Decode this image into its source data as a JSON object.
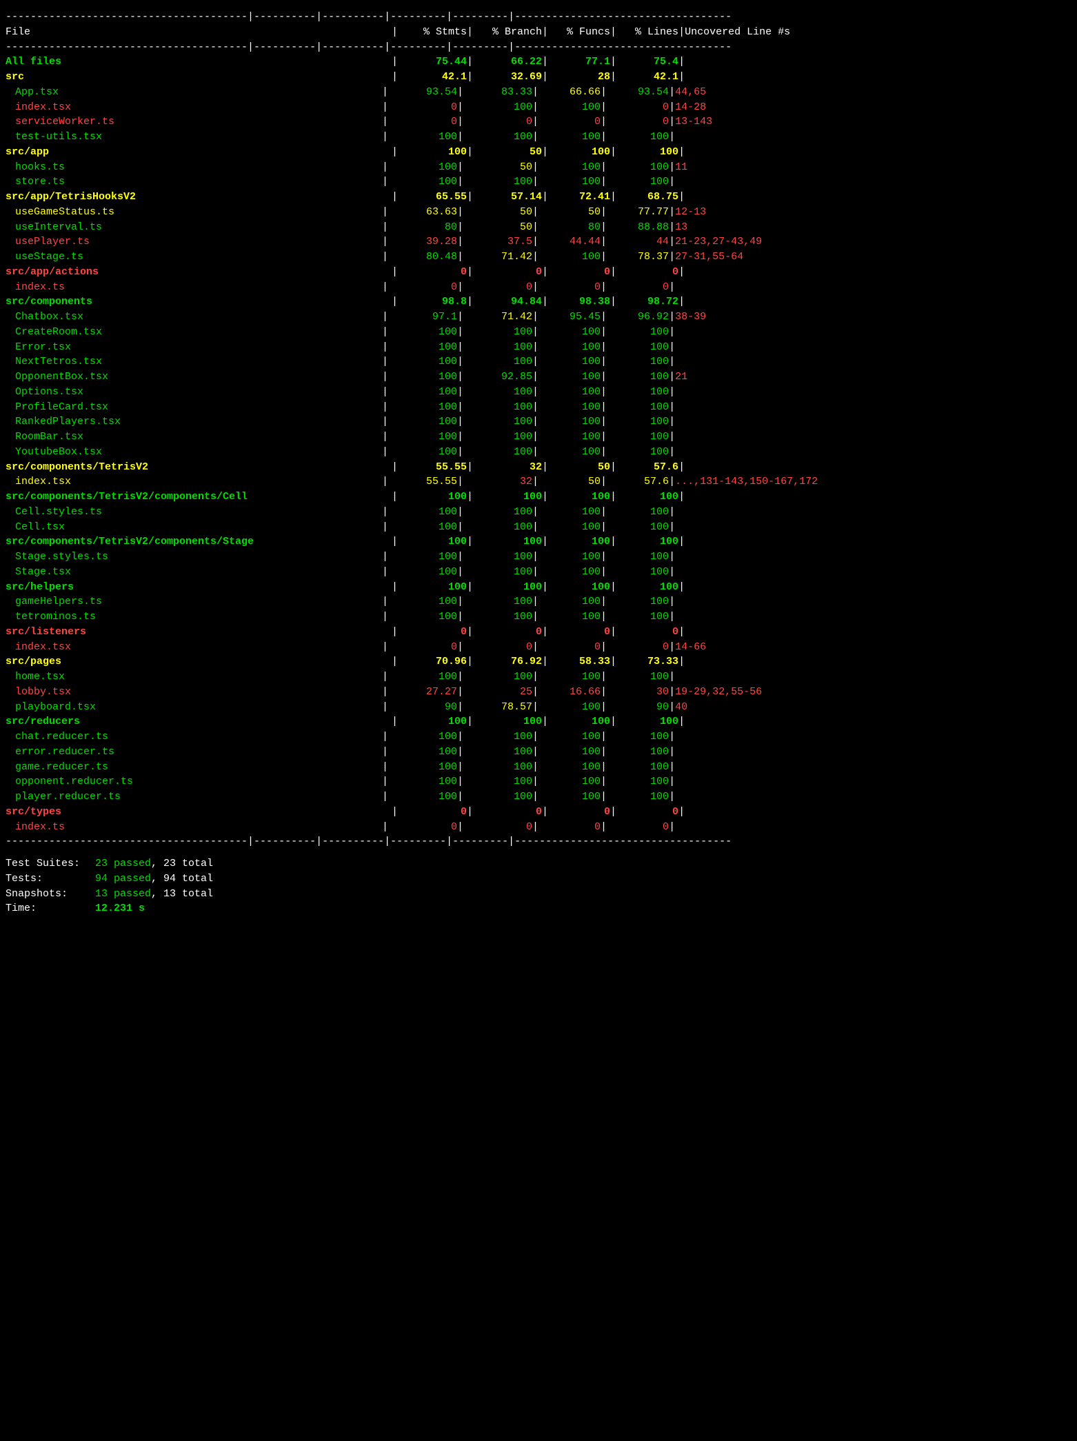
{
  "header": {
    "divider_top": "---------------------------------------",
    "col_file": "File",
    "col_stmts": "% Stmts",
    "col_branch": "% Branch",
    "col_funcs": "% Funcs",
    "col_lines": "% Lines",
    "col_uncov": "Uncovered Line #s"
  },
  "rows": [
    {
      "name": "All files",
      "type": "section",
      "stmts": "75.44",
      "branch": "66.22",
      "funcs": "77.1",
      "lines": "75.4",
      "uncov": "",
      "color": "green",
      "indent": 0
    },
    {
      "name": "src",
      "type": "section",
      "stmts": "42.1",
      "branch": "32.69",
      "funcs": "28",
      "lines": "42.1",
      "uncov": "",
      "color": "yellow",
      "indent": 0
    },
    {
      "name": "App.tsx",
      "type": "file",
      "stmts": "93.54",
      "branch": "83.33",
      "funcs": "66.66",
      "lines": "93.54",
      "uncov": "44,65",
      "color_stmts": "green",
      "color_branch": "green",
      "color_funcs": "yellow",
      "color_lines": "green",
      "color_uncov": "red",
      "indent": 1
    },
    {
      "name": "index.tsx",
      "type": "file",
      "stmts": "0",
      "branch": "100",
      "funcs": "100",
      "lines": "0",
      "uncov": "14-28",
      "color_stmts": "red",
      "color_branch": "green",
      "color_funcs": "green",
      "color_lines": "red",
      "color_uncov": "red",
      "indent": 1
    },
    {
      "name": "serviceWorker.ts",
      "type": "file",
      "stmts": "0",
      "branch": "0",
      "funcs": "0",
      "lines": "0",
      "uncov": "13-143",
      "color_stmts": "red",
      "color_branch": "red",
      "color_funcs": "red",
      "color_lines": "red",
      "color_uncov": "red",
      "indent": 1
    },
    {
      "name": "test-utils.tsx",
      "type": "file",
      "stmts": "100",
      "branch": "100",
      "funcs": "100",
      "lines": "100",
      "uncov": "",
      "color_stmts": "green",
      "color_branch": "green",
      "color_funcs": "green",
      "color_lines": "green",
      "color_uncov": "",
      "indent": 1
    },
    {
      "name": "src/app",
      "type": "section",
      "stmts": "100",
      "branch": "50",
      "funcs": "100",
      "lines": "100",
      "uncov": "",
      "color": "yellow",
      "indent": 0
    },
    {
      "name": "hooks.ts",
      "type": "file",
      "stmts": "100",
      "branch": "50",
      "funcs": "100",
      "lines": "100",
      "uncov": "11",
      "color_stmts": "green",
      "color_branch": "yellow",
      "color_funcs": "green",
      "color_lines": "green",
      "color_uncov": "red",
      "indent": 1
    },
    {
      "name": "store.ts",
      "type": "file",
      "stmts": "100",
      "branch": "100",
      "funcs": "100",
      "lines": "100",
      "uncov": "",
      "color_stmts": "green",
      "color_branch": "green",
      "color_funcs": "green",
      "color_lines": "green",
      "color_uncov": "",
      "indent": 1
    },
    {
      "name": "src/app/TetrisHooksV2",
      "type": "section",
      "stmts": "65.55",
      "branch": "57.14",
      "funcs": "72.41",
      "lines": "68.75",
      "uncov": "",
      "color": "yellow",
      "indent": 0
    },
    {
      "name": "useGameStatus.ts",
      "type": "file",
      "stmts": "63.63",
      "branch": "50",
      "funcs": "50",
      "lines": "77.77",
      "uncov": "12-13",
      "color_stmts": "yellow",
      "color_branch": "yellow",
      "color_funcs": "yellow",
      "color_lines": "yellow",
      "color_uncov": "red",
      "indent": 1
    },
    {
      "name": "useInterval.ts",
      "type": "file",
      "stmts": "80",
      "branch": "50",
      "funcs": "80",
      "lines": "88.88",
      "uncov": "13",
      "color_stmts": "green",
      "color_branch": "yellow",
      "color_funcs": "green",
      "color_lines": "green",
      "color_uncov": "red",
      "indent": 1
    },
    {
      "name": "usePlayer.ts",
      "type": "file",
      "stmts": "39.28",
      "branch": "37.5",
      "funcs": "44.44",
      "lines": "44",
      "uncov": "21-23,27-43,49",
      "color_stmts": "red",
      "color_branch": "red",
      "color_funcs": "red",
      "color_lines": "red",
      "color_uncov": "red",
      "indent": 1
    },
    {
      "name": "useStage.ts",
      "type": "file",
      "stmts": "80.48",
      "branch": "71.42",
      "funcs": "100",
      "lines": "78.37",
      "uncov": "27-31,55-64",
      "color_stmts": "green",
      "color_branch": "yellow",
      "color_funcs": "green",
      "color_lines": "yellow",
      "color_uncov": "red",
      "indent": 1
    },
    {
      "name": "src/app/actions",
      "type": "section",
      "stmts": "0",
      "branch": "0",
      "funcs": "0",
      "lines": "0",
      "uncov": "",
      "color": "red",
      "indent": 0
    },
    {
      "name": "index.ts",
      "type": "file",
      "stmts": "0",
      "branch": "0",
      "funcs": "0",
      "lines": "0",
      "uncov": "",
      "color_stmts": "red",
      "color_branch": "red",
      "color_funcs": "red",
      "color_lines": "red",
      "color_uncov": "",
      "indent": 1
    },
    {
      "name": "src/components",
      "type": "section",
      "stmts": "98.8",
      "branch": "94.84",
      "funcs": "98.38",
      "lines": "98.72",
      "uncov": "",
      "color": "green",
      "indent": 0
    },
    {
      "name": "Chatbox.tsx",
      "type": "file",
      "stmts": "97.1",
      "branch": "71.42",
      "funcs": "95.45",
      "lines": "96.92",
      "uncov": "38-39",
      "color_stmts": "green",
      "color_branch": "yellow",
      "color_funcs": "green",
      "color_lines": "green",
      "color_uncov": "red",
      "indent": 1
    },
    {
      "name": "CreateRoom.tsx",
      "type": "file",
      "stmts": "100",
      "branch": "100",
      "funcs": "100",
      "lines": "100",
      "uncov": "",
      "color_stmts": "green",
      "color_branch": "green",
      "color_funcs": "green",
      "color_lines": "green",
      "color_uncov": "",
      "indent": 1
    },
    {
      "name": "Error.tsx",
      "type": "file",
      "stmts": "100",
      "branch": "100",
      "funcs": "100",
      "lines": "100",
      "uncov": "",
      "color_stmts": "green",
      "color_branch": "green",
      "color_funcs": "green",
      "color_lines": "green",
      "color_uncov": "",
      "indent": 1
    },
    {
      "name": "NextTetros.tsx",
      "type": "file",
      "stmts": "100",
      "branch": "100",
      "funcs": "100",
      "lines": "100",
      "uncov": "",
      "color_stmts": "green",
      "color_branch": "green",
      "color_funcs": "green",
      "color_lines": "green",
      "color_uncov": "",
      "indent": 1
    },
    {
      "name": "OpponentBox.tsx",
      "type": "file",
      "stmts": "100",
      "branch": "92.85",
      "funcs": "100",
      "lines": "100",
      "uncov": "21",
      "color_stmts": "green",
      "color_branch": "green",
      "color_funcs": "green",
      "color_lines": "green",
      "color_uncov": "red",
      "indent": 1
    },
    {
      "name": "Options.tsx",
      "type": "file",
      "stmts": "100",
      "branch": "100",
      "funcs": "100",
      "lines": "100",
      "uncov": "",
      "color_stmts": "green",
      "color_branch": "green",
      "color_funcs": "green",
      "color_lines": "green",
      "color_uncov": "",
      "indent": 1
    },
    {
      "name": "ProfileCard.tsx",
      "type": "file",
      "stmts": "100",
      "branch": "100",
      "funcs": "100",
      "lines": "100",
      "uncov": "",
      "color_stmts": "green",
      "color_branch": "green",
      "color_funcs": "green",
      "color_lines": "green",
      "color_uncov": "",
      "indent": 1
    },
    {
      "name": "RankedPlayers.tsx",
      "type": "file",
      "stmts": "100",
      "branch": "100",
      "funcs": "100",
      "lines": "100",
      "uncov": "",
      "color_stmts": "green",
      "color_branch": "green",
      "color_funcs": "green",
      "color_lines": "green",
      "color_uncov": "",
      "indent": 1
    },
    {
      "name": "RoomBar.tsx",
      "type": "file",
      "stmts": "100",
      "branch": "100",
      "funcs": "100",
      "lines": "100",
      "uncov": "",
      "color_stmts": "green",
      "color_branch": "green",
      "color_funcs": "green",
      "color_lines": "green",
      "color_uncov": "",
      "indent": 1
    },
    {
      "name": "YoutubeBox.tsx",
      "type": "file",
      "stmts": "100",
      "branch": "100",
      "funcs": "100",
      "lines": "100",
      "uncov": "",
      "color_stmts": "green",
      "color_branch": "green",
      "color_funcs": "green",
      "color_lines": "green",
      "color_uncov": "",
      "indent": 1
    },
    {
      "name": "src/components/TetrisV2",
      "type": "section",
      "stmts": "55.55",
      "branch": "32",
      "funcs": "50",
      "lines": "57.6",
      "uncov": "",
      "color": "yellow",
      "indent": 0
    },
    {
      "name": "index.tsx",
      "type": "file",
      "stmts": "55.55",
      "branch": "32",
      "funcs": "50",
      "lines": "57.6",
      "uncov": "...,131-143,150-167,172",
      "color_stmts": "yellow",
      "color_branch": "red",
      "color_funcs": "yellow",
      "color_lines": "yellow",
      "color_uncov": "red",
      "indent": 1
    },
    {
      "name": "src/components/TetrisV2/components/Cell",
      "type": "section",
      "stmts": "100",
      "branch": "100",
      "funcs": "100",
      "lines": "100",
      "uncov": "",
      "color": "green",
      "indent": 0
    },
    {
      "name": "Cell.styles.ts",
      "type": "file",
      "stmts": "100",
      "branch": "100",
      "funcs": "100",
      "lines": "100",
      "uncov": "",
      "color_stmts": "green",
      "color_branch": "green",
      "color_funcs": "green",
      "color_lines": "green",
      "color_uncov": "",
      "indent": 1
    },
    {
      "name": "Cell.tsx",
      "type": "file",
      "stmts": "100",
      "branch": "100",
      "funcs": "100",
      "lines": "100",
      "uncov": "",
      "color_stmts": "green",
      "color_branch": "green",
      "color_funcs": "green",
      "color_lines": "green",
      "color_uncov": "",
      "indent": 1
    },
    {
      "name": "src/components/TetrisV2/components/Stage",
      "type": "section",
      "stmts": "100",
      "branch": "100",
      "funcs": "100",
      "lines": "100",
      "uncov": "",
      "color": "green",
      "indent": 0
    },
    {
      "name": "Stage.styles.ts",
      "type": "file",
      "stmts": "100",
      "branch": "100",
      "funcs": "100",
      "lines": "100",
      "uncov": "",
      "color_stmts": "green",
      "color_branch": "green",
      "color_funcs": "green",
      "color_lines": "green",
      "color_uncov": "",
      "indent": 1
    },
    {
      "name": "Stage.tsx",
      "type": "file",
      "stmts": "100",
      "branch": "100",
      "funcs": "100",
      "lines": "100",
      "uncov": "",
      "color_stmts": "green",
      "color_branch": "green",
      "color_funcs": "green",
      "color_lines": "green",
      "color_uncov": "",
      "indent": 1
    },
    {
      "name": "src/helpers",
      "type": "section",
      "stmts": "100",
      "branch": "100",
      "funcs": "100",
      "lines": "100",
      "uncov": "",
      "color": "green",
      "indent": 0
    },
    {
      "name": "gameHelpers.ts",
      "type": "file",
      "stmts": "100",
      "branch": "100",
      "funcs": "100",
      "lines": "100",
      "uncov": "",
      "color_stmts": "green",
      "color_branch": "green",
      "color_funcs": "green",
      "color_lines": "green",
      "color_uncov": "",
      "indent": 1
    },
    {
      "name": "tetrominos.ts",
      "type": "file",
      "stmts": "100",
      "branch": "100",
      "funcs": "100",
      "lines": "100",
      "uncov": "",
      "color_stmts": "green",
      "color_branch": "green",
      "color_funcs": "green",
      "color_lines": "green",
      "color_uncov": "",
      "indent": 1
    },
    {
      "name": "src/listeners",
      "type": "section",
      "stmts": "0",
      "branch": "0",
      "funcs": "0",
      "lines": "0",
      "uncov": "",
      "color": "red",
      "indent": 0
    },
    {
      "name": "index.tsx",
      "type": "file",
      "stmts": "0",
      "branch": "0",
      "funcs": "0",
      "lines": "0",
      "uncov": "14-66",
      "color_stmts": "red",
      "color_branch": "red",
      "color_funcs": "red",
      "color_lines": "red",
      "color_uncov": "red",
      "indent": 1
    },
    {
      "name": "src/pages",
      "type": "section",
      "stmts": "70.96",
      "branch": "76.92",
      "funcs": "58.33",
      "lines": "73.33",
      "uncov": "",
      "color": "yellow",
      "indent": 0
    },
    {
      "name": "home.tsx",
      "type": "file",
      "stmts": "100",
      "branch": "100",
      "funcs": "100",
      "lines": "100",
      "uncov": "",
      "color_stmts": "green",
      "color_branch": "green",
      "color_funcs": "green",
      "color_lines": "green",
      "color_uncov": "",
      "indent": 1
    },
    {
      "name": "lobby.tsx",
      "type": "file",
      "stmts": "27.27",
      "branch": "25",
      "funcs": "16.66",
      "lines": "30",
      "uncov": "19-29,32,55-56",
      "color_stmts": "red",
      "color_branch": "red",
      "color_funcs": "red",
      "color_lines": "red",
      "color_uncov": "red",
      "indent": 1
    },
    {
      "name": "playboard.tsx",
      "type": "file",
      "stmts": "90",
      "branch": "78.57",
      "funcs": "100",
      "lines": "90",
      "uncov": "40",
      "color_stmts": "green",
      "color_branch": "yellow",
      "color_funcs": "green",
      "color_lines": "green",
      "color_uncov": "red",
      "indent": 1
    },
    {
      "name": "src/reducers",
      "type": "section",
      "stmts": "100",
      "branch": "100",
      "funcs": "100",
      "lines": "100",
      "uncov": "",
      "color": "green",
      "indent": 0
    },
    {
      "name": "chat.reducer.ts",
      "type": "file",
      "stmts": "100",
      "branch": "100",
      "funcs": "100",
      "lines": "100",
      "uncov": "",
      "color_stmts": "green",
      "color_branch": "green",
      "color_funcs": "green",
      "color_lines": "green",
      "color_uncov": "",
      "indent": 1
    },
    {
      "name": "error.reducer.ts",
      "type": "file",
      "stmts": "100",
      "branch": "100",
      "funcs": "100",
      "lines": "100",
      "uncov": "",
      "color_stmts": "green",
      "color_branch": "green",
      "color_funcs": "green",
      "color_lines": "green",
      "color_uncov": "",
      "indent": 1
    },
    {
      "name": "game.reducer.ts",
      "type": "file",
      "stmts": "100",
      "branch": "100",
      "funcs": "100",
      "lines": "100",
      "uncov": "",
      "color_stmts": "green",
      "color_branch": "green",
      "color_funcs": "green",
      "color_lines": "green",
      "color_uncov": "",
      "indent": 1
    },
    {
      "name": "opponent.reducer.ts",
      "type": "file",
      "stmts": "100",
      "branch": "100",
      "funcs": "100",
      "lines": "100",
      "uncov": "",
      "color_stmts": "green",
      "color_branch": "green",
      "color_funcs": "green",
      "color_lines": "green",
      "color_uncov": "",
      "indent": 1
    },
    {
      "name": "player.reducer.ts",
      "type": "file",
      "stmts": "100",
      "branch": "100",
      "funcs": "100",
      "lines": "100",
      "uncov": "",
      "color_stmts": "green",
      "color_branch": "green",
      "color_funcs": "green",
      "color_lines": "green",
      "color_uncov": "",
      "indent": 1
    },
    {
      "name": "src/types",
      "type": "section",
      "stmts": "0",
      "branch": "0",
      "funcs": "0",
      "lines": "0",
      "uncov": "",
      "color": "red",
      "indent": 0
    },
    {
      "name": "index.ts",
      "type": "file",
      "stmts": "0",
      "branch": "0",
      "funcs": "0",
      "lines": "0",
      "uncov": "",
      "color_stmts": "red",
      "color_branch": "red",
      "color_funcs": "red",
      "color_lines": "red",
      "color_uncov": "",
      "indent": 1
    }
  ],
  "summary": {
    "test_suites_label": "Test Suites:",
    "test_suites_passed": "23 passed",
    "test_suites_total": "23 total",
    "tests_label": "Tests:",
    "tests_passed": "94 passed",
    "tests_total": "94 total",
    "snapshots_label": "Snapshots:",
    "snapshots_passed": "13 passed",
    "snapshots_total": "13 total",
    "time_label": "Time:",
    "time_value": "12.231 s"
  }
}
